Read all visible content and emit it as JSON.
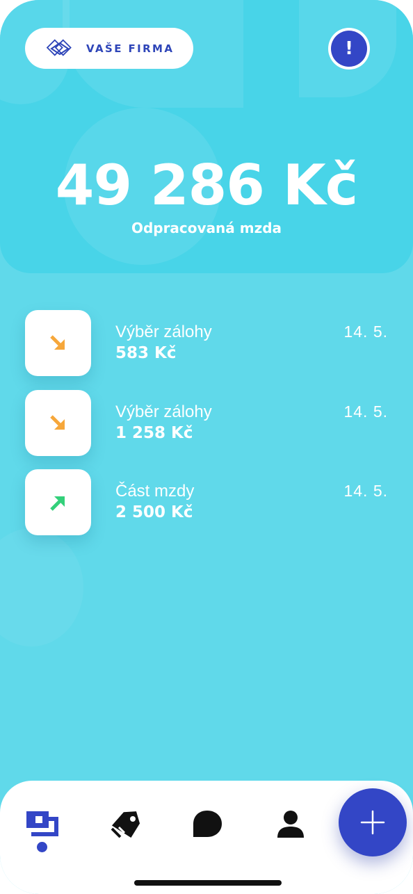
{
  "header": {
    "company_name": "VAŠE FIRMA",
    "logo_icon": "diamond-logo-icon",
    "alert_label": "!"
  },
  "balance": {
    "amount": "49 286 Kč",
    "label": "Odpracovaná mzda"
  },
  "transactions": [
    {
      "title": "Výběr zálohy",
      "amount": "583 Kč",
      "date": "14. 5.",
      "icon": "arrow-down-right-icon",
      "color": "#f6a73a"
    },
    {
      "title": "Výběr zálohy",
      "amount": "1 258 Kč",
      "date": "14. 5.",
      "icon": "arrow-down-right-icon",
      "color": "#f6a73a"
    },
    {
      "title": "Část mzdy",
      "amount": "2 500 Kč",
      "date": "14. 5.",
      "icon": "arrow-up-right-icon",
      "color": "#33d07a"
    }
  ],
  "nav": {
    "items": [
      {
        "name": "overview",
        "icon": "wallet-stack-icon",
        "active": true
      },
      {
        "name": "offers",
        "icon": "tag-icon",
        "active": false
      },
      {
        "name": "messages",
        "icon": "chat-bubble-icon",
        "active": false
      },
      {
        "name": "profile",
        "icon": "user-icon",
        "active": false
      }
    ],
    "fab_icon": "plus-icon"
  },
  "colors": {
    "background": "#60d9ea",
    "hero": "#48d4e8",
    "accent": "#3346c6",
    "withdrawal": "#f6a73a",
    "income": "#33d07a"
  }
}
